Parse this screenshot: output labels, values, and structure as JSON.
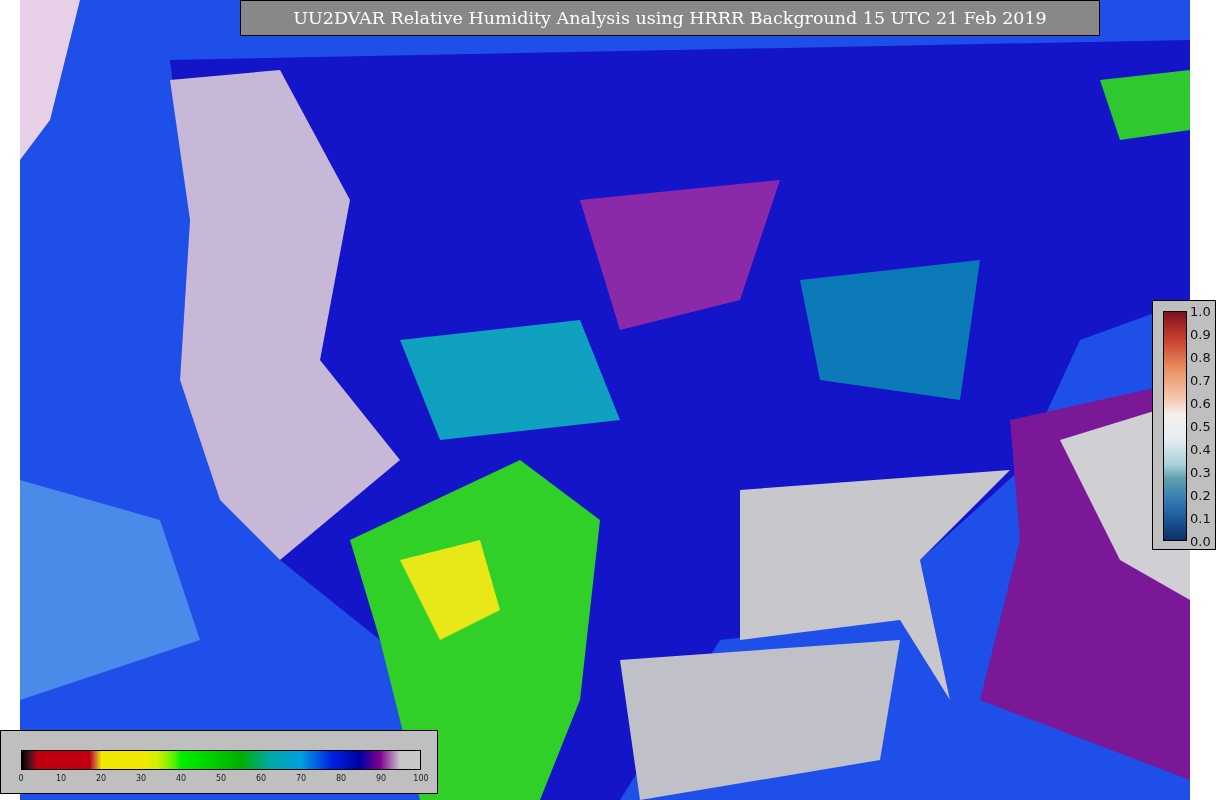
{
  "title": "UU2DVAR Relative Humidity Analysis using HRRR Background 15 UTC 21 Feb 2019",
  "humidity_colorbar": {
    "ticks": [
      "0",
      "10",
      "20",
      "30",
      "40",
      "50",
      "60",
      "70",
      "80",
      "90",
      "100"
    ]
  },
  "ratio_colorbar": {
    "ticks": [
      "1.0",
      "0.9",
      "0.8",
      "0.7",
      "0.6",
      "0.5",
      "0.4",
      "0.3",
      "0.2",
      "0.1",
      "0.0"
    ]
  }
}
